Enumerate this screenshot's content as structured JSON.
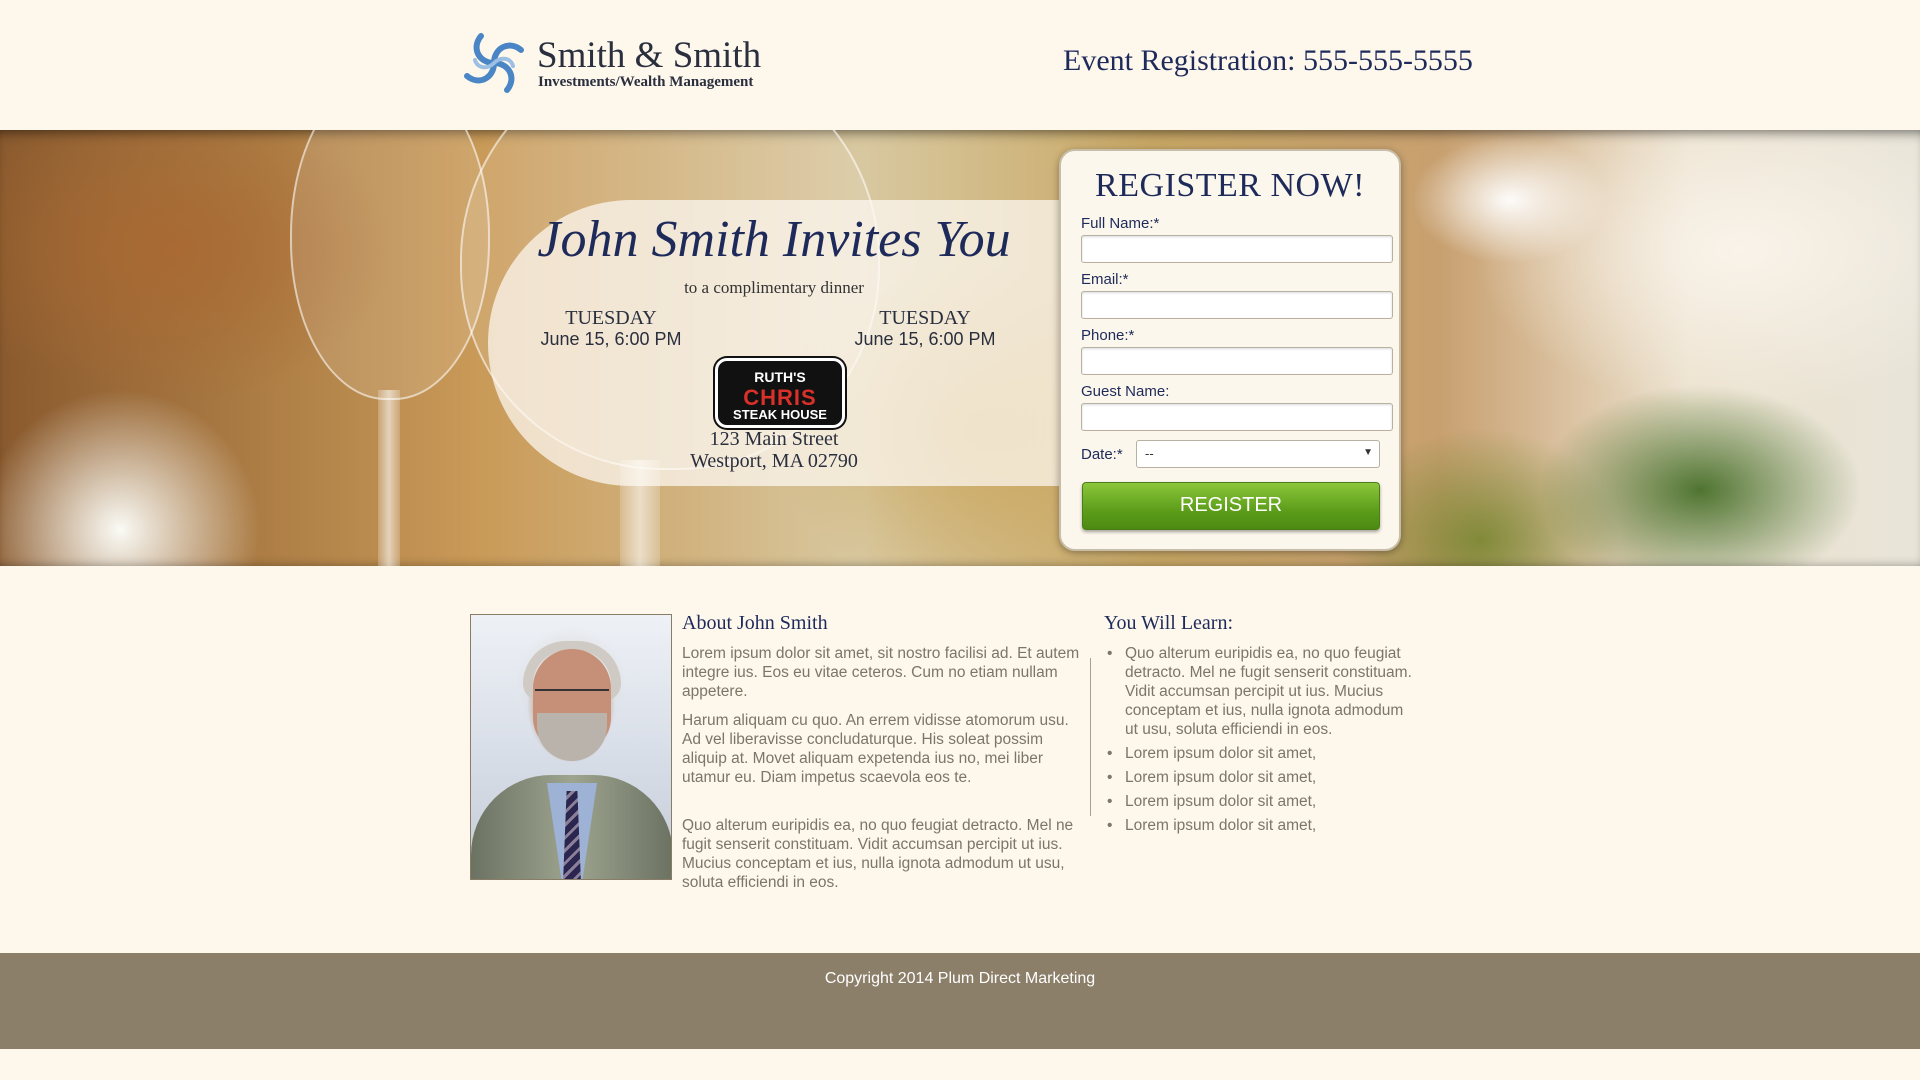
{
  "header": {
    "brand_name": "Smith & Smith",
    "brand_tagline": "Investments/Wealth Management",
    "event_registration": "Event Registration: 555-555-5555"
  },
  "invite": {
    "title": "John Smith Invites You",
    "subtitle": "to a complimentary dinner",
    "dates": [
      {
        "day": "TUESDAY",
        "time": "June 15, 6:00 PM"
      },
      {
        "day": "TUESDAY",
        "time": "June 15, 6:00 PM"
      }
    ],
    "restaurant_logo": {
      "line1": "RUTH'S",
      "line2": "CHRIS",
      "line3": "STEAK HOUSE"
    },
    "address_line1": "123 Main Street",
    "address_line2": "Westport, MA 02790"
  },
  "form": {
    "title": "REGISTER NOW!",
    "full_name_label": "Full Name:*",
    "email_label": "Email:*",
    "phone_label": "Phone:*",
    "guest_label": "Guest Name:",
    "date_label": "Date:*",
    "date_value": "--",
    "submit_label": "REGISTER"
  },
  "about": {
    "title": "About John Smith",
    "paragraphs": [
      "Lorem ipsum dolor sit amet, sit nostro facilisi ad. Et autem integre ius. Eos eu vitae ceteros. Cum no etiam nullam appetere.",
      "Harum aliquam cu quo. An errem vidisse atomorum usu. Ad vel liberavisse concludaturque. His soleat possim aliquip at. Movet aliquam expetenda ius no, mei liber utamur eu. Diam impetus scaevola eos te.",
      "Quo alterum euripidis ea, no quo feugiat detracto. Mel ne fugit senserit constituam. Vidit accumsan percipit ut ius. Mucius conceptam et ius, nulla ignota admodum ut usu, soluta efficiendi in eos."
    ]
  },
  "learn": {
    "title": "You Will Learn:",
    "items": [
      "Quo alterum euripidis ea, no quo feugiat detracto. Mel ne fugit senserit constituam. Vidit accumsan percipit ut ius. Mucius conceptam et ius, nulla ignota admodum ut usu, soluta efficiendi in eos.",
      "Lorem ipsum dolor sit amet,",
      "Lorem ipsum dolor sit amet,",
      "Lorem ipsum dolor sit amet,",
      "Lorem ipsum dolor sit amet,"
    ]
  },
  "footer": {
    "copyright": "Copyright 2014 Plum Direct Marketing"
  },
  "colors": {
    "background": "#fdf7ec",
    "navy": "#1e2a5a",
    "button_green": "#5c9d1a",
    "footer": "#8c7f6a",
    "logo_blue": "#4a86c5"
  },
  "icons": {
    "brand_logo": "swirl-logo-icon",
    "select_arrow": "chevron-down-icon"
  }
}
